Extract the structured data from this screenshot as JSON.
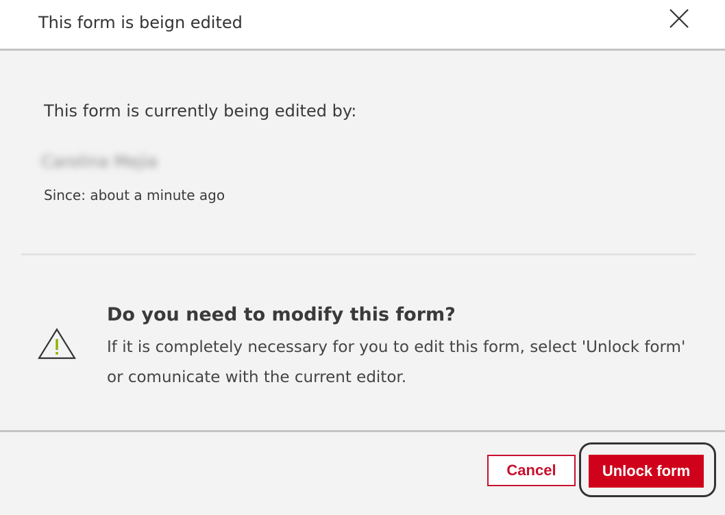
{
  "header": {
    "title": "This form is beign edited",
    "close_icon": "close-icon"
  },
  "lock_info": {
    "label": "This form is currently being edited by:",
    "editor_name": "Carolina Mejia",
    "since": "Since: about a minute ago"
  },
  "warning": {
    "icon": "warning-triangle-icon",
    "icon_color": "#8cb400",
    "heading": "Do you need to modify this form?",
    "body_line_1": "If it is completely necessary for you to edit this form, select 'Unlock form'",
    "body_line_2": "or comunicate with the current editor."
  },
  "footer": {
    "cancel_label": "Cancel",
    "unlock_label": "Unlock form",
    "accent_color": "#d0021b"
  }
}
